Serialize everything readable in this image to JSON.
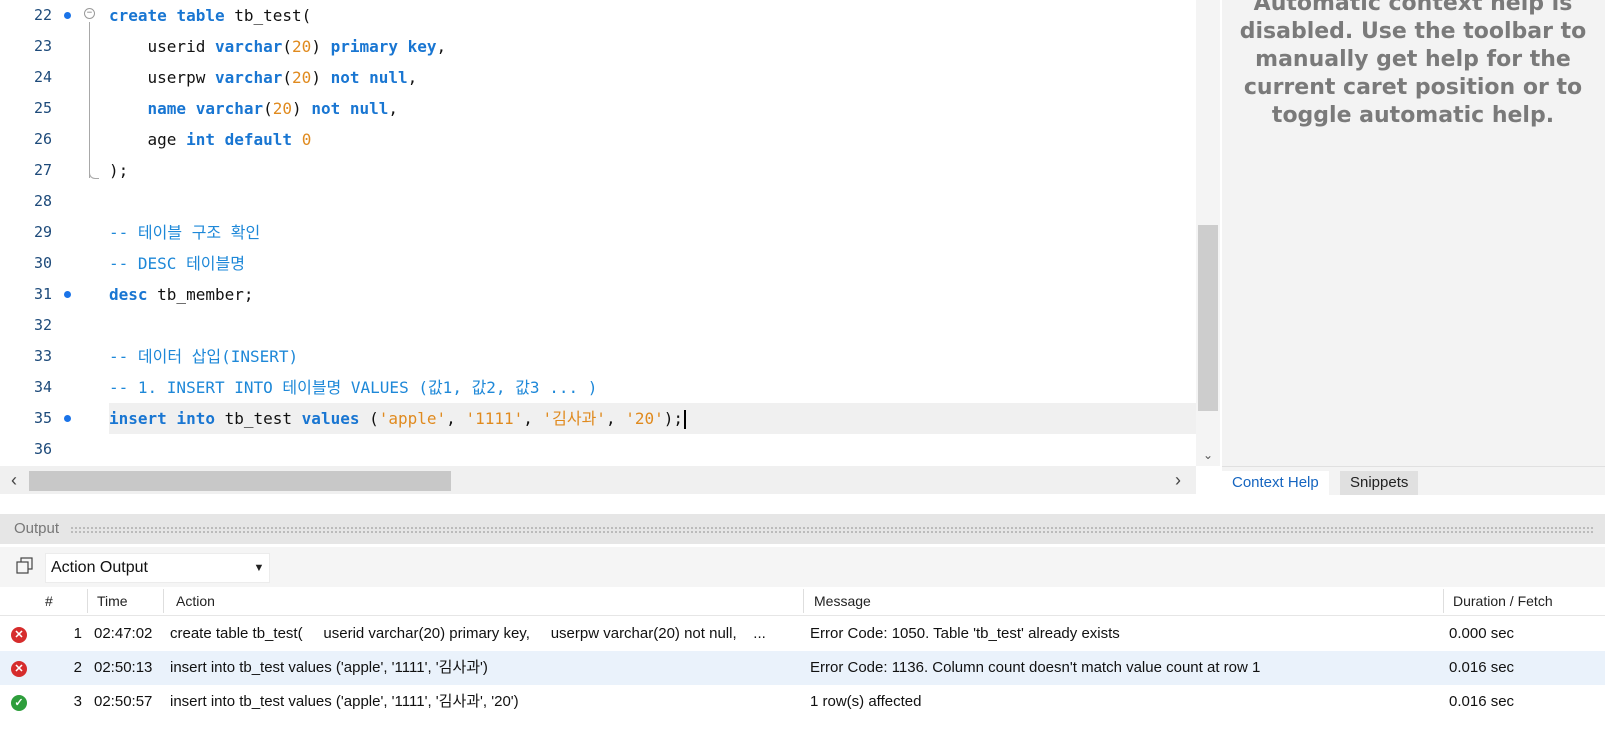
{
  "editor": {
    "lines": [
      {
        "n": "22",
        "bp": true,
        "fold": true,
        "tokens": [
          [
            "kw",
            "create"
          ],
          [
            "plain",
            " "
          ],
          [
            "kw",
            "table"
          ],
          [
            "plain",
            " tb_test("
          ]
        ]
      },
      {
        "n": "23",
        "bp": false,
        "tokens": [
          [
            "plain",
            "    userid "
          ],
          [
            "kw",
            "varchar"
          ],
          [
            "plain",
            "("
          ],
          [
            "num",
            "20"
          ],
          [
            "plain",
            ") "
          ],
          [
            "kw",
            "primary key"
          ],
          [
            "plain",
            ","
          ]
        ]
      },
      {
        "n": "24",
        "bp": false,
        "tokens": [
          [
            "plain",
            "    userpw "
          ],
          [
            "kw",
            "varchar"
          ],
          [
            "plain",
            "("
          ],
          [
            "num",
            "20"
          ],
          [
            "plain",
            ") "
          ],
          [
            "kw",
            "not null"
          ],
          [
            "plain",
            ","
          ]
        ]
      },
      {
        "n": "25",
        "bp": false,
        "tokens": [
          [
            "plain",
            "    "
          ],
          [
            "kw",
            "name"
          ],
          [
            "plain",
            " "
          ],
          [
            "kw",
            "varchar"
          ],
          [
            "plain",
            "("
          ],
          [
            "num",
            "20"
          ],
          [
            "plain",
            ") "
          ],
          [
            "kw",
            "not null"
          ],
          [
            "plain",
            ","
          ]
        ]
      },
      {
        "n": "26",
        "bp": false,
        "tokens": [
          [
            "plain",
            "    age "
          ],
          [
            "kw",
            "int"
          ],
          [
            "plain",
            " "
          ],
          [
            "kw",
            "default"
          ],
          [
            "plain",
            " "
          ],
          [
            "num",
            "0"
          ]
        ]
      },
      {
        "n": "27",
        "bp": false,
        "tokens": [
          [
            "plain",
            ");"
          ]
        ]
      },
      {
        "n": "28",
        "bp": false,
        "tokens": []
      },
      {
        "n": "29",
        "bp": false,
        "tokens": [
          [
            "cmt",
            "-- 테이블 구조 확인"
          ]
        ]
      },
      {
        "n": "30",
        "bp": false,
        "tokens": [
          [
            "cmt",
            "-- DESC 테이블명"
          ]
        ]
      },
      {
        "n": "31",
        "bp": true,
        "tokens": [
          [
            "kw",
            "desc"
          ],
          [
            "plain",
            " tb_member;"
          ]
        ]
      },
      {
        "n": "32",
        "bp": false,
        "tokens": []
      },
      {
        "n": "33",
        "bp": false,
        "tokens": [
          [
            "cmt",
            "-- 데이터 삽입(INSERT)"
          ]
        ]
      },
      {
        "n": "34",
        "bp": false,
        "tokens": [
          [
            "cmt",
            "-- 1. INSERT INTO 테이블명 VALUES (값1, 값2, 값3 ... )"
          ]
        ]
      },
      {
        "n": "35",
        "bp": true,
        "current": true,
        "tokens": [
          [
            "kw",
            "insert"
          ],
          [
            "plain",
            " "
          ],
          [
            "kw",
            "into"
          ],
          [
            "plain",
            " tb_test "
          ],
          [
            "kw",
            "values"
          ],
          [
            "plain",
            " ("
          ],
          [
            "str",
            "'apple'"
          ],
          [
            "plain",
            ", "
          ],
          [
            "str",
            "'1111'"
          ],
          [
            "plain",
            ", "
          ],
          [
            "str",
            "'김사과'"
          ],
          [
            "plain",
            ", "
          ],
          [
            "str",
            "'20'"
          ],
          [
            "plain",
            ");"
          ]
        ]
      },
      {
        "n": "36",
        "bp": false,
        "tokens": []
      }
    ]
  },
  "help": {
    "text": "Automatic context help is\ndisabled. Use the toolbar to\nmanually get help for the\ncurrent caret position or to\ntoggle automatic help.",
    "tabs": [
      "Context Help",
      "Snippets"
    ]
  },
  "output": {
    "title": "Output",
    "selector": "Action Output",
    "columns": [
      "#",
      "Time",
      "Action",
      "Message",
      "Duration / Fetch"
    ],
    "rows": [
      {
        "status": "error",
        "num": "1",
        "time": "02:47:02",
        "action": "create table tb_test(     userid varchar(20) primary key,     userpw varchar(20) not null,    ...",
        "message": "Error Code: 1050. Table 'tb_test' already exists",
        "duration": "0.000 sec"
      },
      {
        "status": "error",
        "num": "2",
        "time": "02:50:13",
        "action": "insert into tb_test values ('apple', '1111', '김사과')",
        "message": "Error Code: 1136. Column count doesn't match value count at row 1",
        "duration": "0.016 sec"
      },
      {
        "status": "ok",
        "num": "3",
        "time": "02:50:57",
        "action": "insert into tb_test values ('apple', '1111', '김사과', '20')",
        "message": "1 row(s) affected",
        "duration": "0.016 sec"
      }
    ]
  },
  "colors": {
    "keyword": "#1976d2",
    "literal": "#e08a1e",
    "comment": "#1e88d8",
    "error": "#d62c2c",
    "success": "#2e9e3c"
  }
}
